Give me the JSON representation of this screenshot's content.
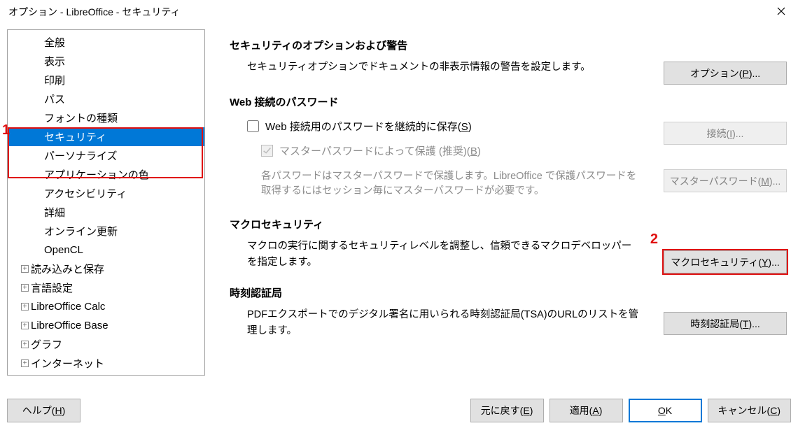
{
  "title": "オプション - LibreOffice - セキュリティ",
  "annotations": {
    "a1": "1",
    "a2": "2"
  },
  "tree": {
    "items": [
      {
        "label": "全般",
        "level": 2
      },
      {
        "label": "表示",
        "level": 2
      },
      {
        "label": "印刷",
        "level": 2
      },
      {
        "label": "パス",
        "level": 2
      },
      {
        "label": "フォントの種類",
        "level": 2
      },
      {
        "label": "セキュリティ",
        "level": 2,
        "selected": true
      },
      {
        "label": "パーソナライズ",
        "level": 2
      },
      {
        "label": "アプリケーションの色",
        "level": 2
      },
      {
        "label": "アクセシビリティ",
        "level": 2
      },
      {
        "label": "詳細",
        "level": 2
      },
      {
        "label": "オンライン更新",
        "level": 2
      },
      {
        "label": "OpenCL",
        "level": 2
      },
      {
        "label": "読み込みと保存",
        "level": 1,
        "expander": true
      },
      {
        "label": "言語設定",
        "level": 1,
        "expander": true
      },
      {
        "label": "LibreOffice Calc",
        "level": 1,
        "expander": true
      },
      {
        "label": "LibreOffice Base",
        "level": 1,
        "expander": true
      },
      {
        "label": "グラフ",
        "level": 1,
        "expander": true
      },
      {
        "label": "インターネット",
        "level": 1,
        "expander": true
      }
    ]
  },
  "sections": {
    "sec1": {
      "title": "セキュリティのオプションおよび警告",
      "body": "セキュリティオプションでドキュメントの非表示情報の警告を設定します。"
    },
    "sec2": {
      "title": "Web 接続のパスワード",
      "check1_pre": "Web 接続用のパスワードを継続的に保存(",
      "check1_key": "S",
      "check1_post": ")",
      "check2_pre": "マスターパスワードによって保護 (推奨)(",
      "check2_key": "B",
      "check2_post": ")",
      "note": "各パスワードはマスターパスワードで保護します。LibreOffice で保護パスワードを取得するにはセッション毎にマスターパスワードが必要です。"
    },
    "sec3": {
      "title": "マクロセキュリティ",
      "body": "マクロの実行に関するセキュリティレベルを調整し、信頼できるマクロデベロッパーを指定します。"
    },
    "sec4": {
      "title": "時刻認証局",
      "body": "PDFエクスポートでのデジタル署名に用いられる時刻認証局(TSA)のURLのリストを管理します。"
    }
  },
  "buttons": {
    "b_options_pre": "オプション(",
    "b_options_key": "P",
    "b_options_post": ")...",
    "b_conn_pre": "接続(",
    "b_conn_key": "I",
    "b_conn_post": ")...",
    "b_mpwd_pre": "マスターパスワード(",
    "b_mpwd_key": "M",
    "b_mpwd_post": ")...",
    "b_macro_pre": "マクロセキュリティ(",
    "b_macro_key": "Y",
    "b_macro_post": ")...",
    "b_tsa_pre": "時刻認証局(",
    "b_tsa_key": "T",
    "b_tsa_post": ")..."
  },
  "footer": {
    "help_pre": "ヘルプ(",
    "help_key": "H",
    "help_post": ")",
    "revert_pre": "元に戻す(",
    "revert_key": "E",
    "revert_post": ")",
    "apply_pre": "適用(",
    "apply_key": "A",
    "apply_post": ")",
    "ok_pre": "",
    "ok_key": "O",
    "ok_mid": "K",
    "ok_post": "",
    "cancel_pre": "キャンセル(",
    "cancel_key": "C",
    "cancel_post": ")"
  }
}
